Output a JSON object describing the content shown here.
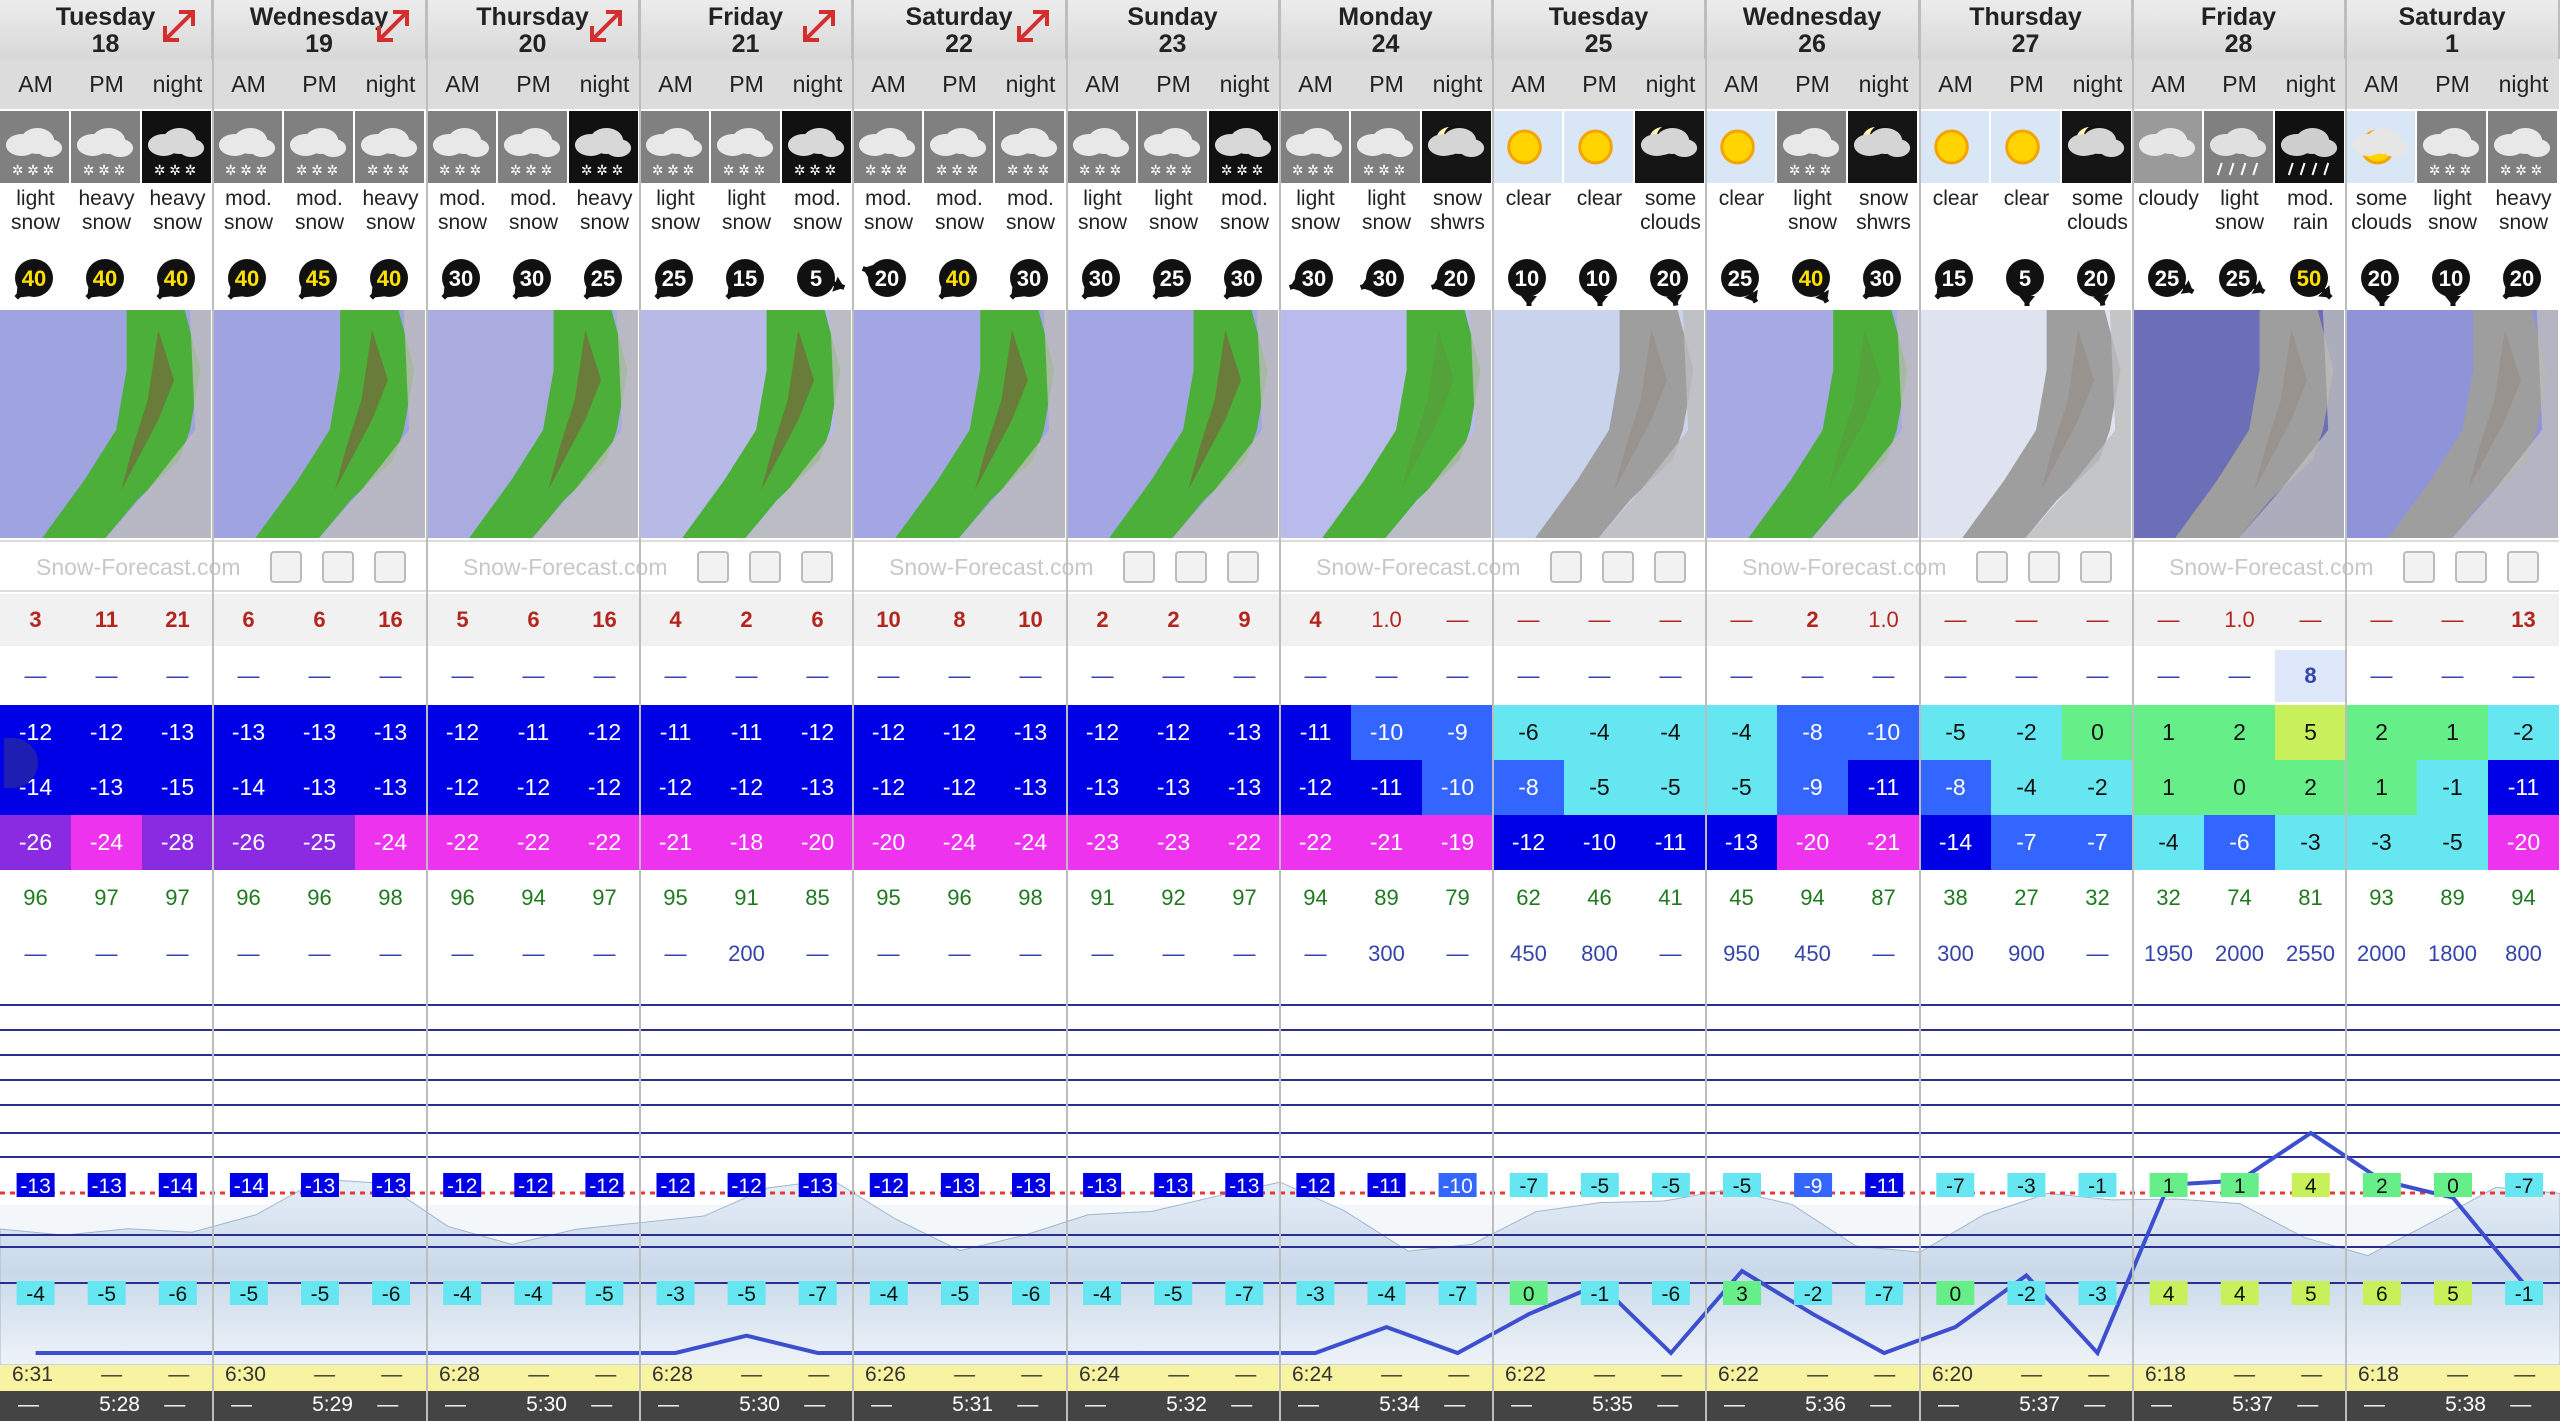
{
  "days": [
    {
      "name": "Tuesday",
      "num": "18",
      "arrow": true
    },
    {
      "name": "Wednesday",
      "num": "19",
      "arrow": true
    },
    {
      "name": "Thursday",
      "num": "20",
      "arrow": true
    },
    {
      "name": "Friday",
      "num": "21",
      "arrow": true
    },
    {
      "name": "Saturday",
      "num": "22",
      "arrow": true
    },
    {
      "name": "Sunday",
      "num": "23",
      "arrow": false
    },
    {
      "name": "Monday",
      "num": "24",
      "arrow": false
    },
    {
      "name": "Tuesday",
      "num": "25",
      "arrow": false
    },
    {
      "name": "Wednesday",
      "num": "26",
      "arrow": false
    },
    {
      "name": "Thursday",
      "num": "27",
      "arrow": false
    },
    {
      "name": "Friday",
      "num": "28",
      "arrow": false
    },
    {
      "name": "Saturday",
      "num": "1",
      "arrow": false
    }
  ],
  "periods": [
    "AM",
    "PM",
    "night"
  ],
  "weather": [
    [
      "light snow",
      "heavy snow",
      "heavy snow"
    ],
    [
      "mod. snow",
      "mod. snow",
      "heavy snow"
    ],
    [
      "mod. snow",
      "mod. snow",
      "heavy snow"
    ],
    [
      "light snow",
      "light snow",
      "mod. snow"
    ],
    [
      "mod. snow",
      "mod. snow",
      "mod. snow"
    ],
    [
      "light snow",
      "light snow",
      "mod. snow"
    ],
    [
      "light snow",
      "light snow",
      "snow shwrs"
    ],
    [
      "clear",
      "clear",
      "some clouds"
    ],
    [
      "clear",
      "light snow",
      "snow shwrs"
    ],
    [
      "clear",
      "clear",
      "some clouds"
    ],
    [
      "cloudy",
      "light snow",
      "mod. rain"
    ],
    [
      "some clouds",
      "light snow",
      "heavy snow"
    ]
  ],
  "icons": [
    [
      "snow-cloud",
      "snow-cloud",
      "snow-night"
    ],
    [
      "snow-cloud",
      "snow-cloud",
      "snow-cloud"
    ],
    [
      "snow-cloud",
      "snow-cloud",
      "snow-night"
    ],
    [
      "snow-cloud",
      "snow-cloud",
      "snow-night"
    ],
    [
      "snow-cloud",
      "snow-cloud",
      "snow-cloud"
    ],
    [
      "snow-cloud",
      "snow-cloud",
      "snow-night"
    ],
    [
      "snow-cloud",
      "snow-cloud",
      "moon-cloud"
    ],
    [
      "sun",
      "sun",
      "moon-cloud"
    ],
    [
      "sun",
      "snow-cloud",
      "moon-cloud"
    ],
    [
      "sun",
      "sun",
      "moon-cloud"
    ],
    [
      "cloud",
      "rain-cloud",
      "rain-night"
    ],
    [
      "sun-cloud",
      "snow-cloud",
      "snow-cloud"
    ]
  ],
  "wind": [
    [
      "40",
      "40",
      "40"
    ],
    [
      "40",
      "45",
      "40"
    ],
    [
      "30",
      "30",
      "25"
    ],
    [
      "25",
      "15",
      "5"
    ],
    [
      "20",
      "40",
      "30"
    ],
    [
      "30",
      "25",
      "30"
    ],
    [
      "30",
      "30",
      "20"
    ],
    [
      "10",
      "10",
      "20"
    ],
    [
      "25",
      "40",
      "30"
    ],
    [
      "15",
      "5",
      "20"
    ],
    [
      "25",
      "25",
      "50"
    ],
    [
      "20",
      "10",
      "20"
    ]
  ],
  "brand": "Snow-Forecast.com",
  "snow": [
    [
      "3",
      "11",
      "21"
    ],
    [
      "6",
      "6",
      "16"
    ],
    [
      "5",
      "6",
      "16"
    ],
    [
      "4",
      "2",
      "6"
    ],
    [
      "10",
      "8",
      "10"
    ],
    [
      "2",
      "2",
      "9"
    ],
    [
      "4",
      "1.0",
      "—"
    ],
    [
      "—",
      "—",
      "—"
    ],
    [
      "—",
      "2",
      "1.0"
    ],
    [
      "—",
      "—",
      "—"
    ],
    [
      "—",
      "1.0",
      "—"
    ],
    [
      "—",
      "—",
      "13"
    ]
  ],
  "rain": [
    [
      "—",
      "—",
      "—"
    ],
    [
      "—",
      "—",
      "—"
    ],
    [
      "—",
      "—",
      "—"
    ],
    [
      "—",
      "—",
      "—"
    ],
    [
      "—",
      "—",
      "—"
    ],
    [
      "—",
      "—",
      "—"
    ],
    [
      "—",
      "—",
      "—"
    ],
    [
      "—",
      "—",
      "—"
    ],
    [
      "—",
      "—",
      "—"
    ],
    [
      "—",
      "—",
      "—"
    ],
    [
      "—",
      "—",
      "8"
    ],
    [
      "—",
      "—",
      "—"
    ]
  ],
  "tmax": [
    [
      "-12",
      "-12",
      "-13"
    ],
    [
      "-13",
      "-13",
      "-13"
    ],
    [
      "-12",
      "-11",
      "-12"
    ],
    [
      "-11",
      "-11",
      "-12"
    ],
    [
      "-12",
      "-12",
      "-13"
    ],
    [
      "-12",
      "-12",
      "-13"
    ],
    [
      "-11",
      "-10",
      "-9"
    ],
    [
      "-6",
      "-4",
      "-4"
    ],
    [
      "-4",
      "-8",
      "-10"
    ],
    [
      "-5",
      "-2",
      "0"
    ],
    [
      "1",
      "2",
      "5"
    ],
    [
      "2",
      "1",
      "-2"
    ]
  ],
  "tmin": [
    [
      "-14",
      "-13",
      "-15"
    ],
    [
      "-14",
      "-13",
      "-13"
    ],
    [
      "-12",
      "-12",
      "-12"
    ],
    [
      "-12",
      "-12",
      "-13"
    ],
    [
      "-12",
      "-12",
      "-13"
    ],
    [
      "-13",
      "-13",
      "-13"
    ],
    [
      "-12",
      "-11",
      "-10"
    ],
    [
      "-8",
      "-5",
      "-5"
    ],
    [
      "-5",
      "-9",
      "-11"
    ],
    [
      "-8",
      "-4",
      "-2"
    ],
    [
      "1",
      "0",
      "2"
    ],
    [
      "1",
      "-1",
      "-11"
    ]
  ],
  "chill": [
    [
      "-26",
      "-24",
      "-28"
    ],
    [
      "-26",
      "-25",
      "-24"
    ],
    [
      "-22",
      "-22",
      "-22"
    ],
    [
      "-21",
      "-18",
      "-20"
    ],
    [
      "-20",
      "-24",
      "-24"
    ],
    [
      "-23",
      "-23",
      "-22"
    ],
    [
      "-22",
      "-21",
      "-19"
    ],
    [
      "-12",
      "-10",
      "-11"
    ],
    [
      "-13",
      "-20",
      "-21"
    ],
    [
      "-14",
      "-7",
      "-7"
    ],
    [
      "-4",
      "-6",
      "-3"
    ],
    [
      "-3",
      "-5",
      "-20"
    ]
  ],
  "humidity": [
    [
      "96",
      "97",
      "97"
    ],
    [
      "96",
      "96",
      "98"
    ],
    [
      "96",
      "94",
      "97"
    ],
    [
      "95",
      "91",
      "85"
    ],
    [
      "95",
      "96",
      "98"
    ],
    [
      "91",
      "92",
      "97"
    ],
    [
      "94",
      "89",
      "79"
    ],
    [
      "62",
      "46",
      "41"
    ],
    [
      "45",
      "94",
      "87"
    ],
    [
      "38",
      "27",
      "32"
    ],
    [
      "32",
      "74",
      "81"
    ],
    [
      "93",
      "89",
      "94"
    ]
  ],
  "freeze": [
    [
      "—",
      "—",
      "—"
    ],
    [
      "—",
      "—",
      "—"
    ],
    [
      "—",
      "—",
      "—"
    ],
    [
      "—",
      "200",
      "—"
    ],
    [
      "—",
      "—",
      "—"
    ],
    [
      "—",
      "—",
      "—"
    ],
    [
      "—",
      "300",
      "—"
    ],
    [
      "450",
      "800",
      "—"
    ],
    [
      "950",
      "450",
      "—"
    ],
    [
      "300",
      "900",
      "—"
    ],
    [
      "1950",
      "2000",
      "2550"
    ],
    [
      "2000",
      "1800",
      "800"
    ]
  ],
  "upper_temps": [
    [
      "-13",
      "-13",
      "-14"
    ],
    [
      "-14",
      "-13",
      "-13"
    ],
    [
      "-12",
      "-12",
      "-12"
    ],
    [
      "-12",
      "-12",
      "-13"
    ],
    [
      "-12",
      "-13",
      "-13"
    ],
    [
      "-13",
      "-13",
      "-13"
    ],
    [
      "-12",
      "-11",
      "-10"
    ],
    [
      "-7",
      "-5",
      "-5"
    ],
    [
      "-5",
      "-9",
      "-11"
    ],
    [
      "-7",
      "-3",
      "-1"
    ],
    [
      "1",
      "1",
      "4"
    ],
    [
      "2",
      "0",
      "-7"
    ]
  ],
  "lower_temps": [
    [
      "-4",
      "-5",
      "-6"
    ],
    [
      "-5",
      "-5",
      "-6"
    ],
    [
      "-4",
      "-4",
      "-5"
    ],
    [
      "-3",
      "-5",
      "-7"
    ],
    [
      "-4",
      "-5",
      "-6"
    ],
    [
      "-4",
      "-5",
      "-7"
    ],
    [
      "-3",
      "-4",
      "-7"
    ],
    [
      "0",
      "-1",
      "-6"
    ],
    [
      "3",
      "-2",
      "-7"
    ],
    [
      "0",
      "-2",
      "-3"
    ],
    [
      "4",
      "4",
      "5"
    ],
    [
      "6",
      "5",
      "-1"
    ]
  ],
  "sunrise": [
    "6:31",
    "6:30",
    "6:28",
    "6:28",
    "6:26",
    "6:24",
    "6:24",
    "6:22",
    "6:22",
    "6:20",
    "6:18",
    "6:18"
  ],
  "sunset": [
    "5:28",
    "5:29",
    "5:30",
    "5:30",
    "5:31",
    "5:32",
    "5:34",
    "5:35",
    "5:36",
    "5:37",
    "5:37",
    "5:38"
  ],
  "dash": "—",
  "colors": {
    "deep_blue": "#0000e6",
    "mid_blue": "#3366ff",
    "light_blue": "#66e6f0",
    "magenta": "#ee33ee",
    "purple": "#8a2be2",
    "green": "#66ee88",
    "yellow": "#c8f05a",
    "chart_line": "#3d4fcf",
    "freezing_line": "#e53935",
    "sun_band": "#f8f3a0"
  }
}
